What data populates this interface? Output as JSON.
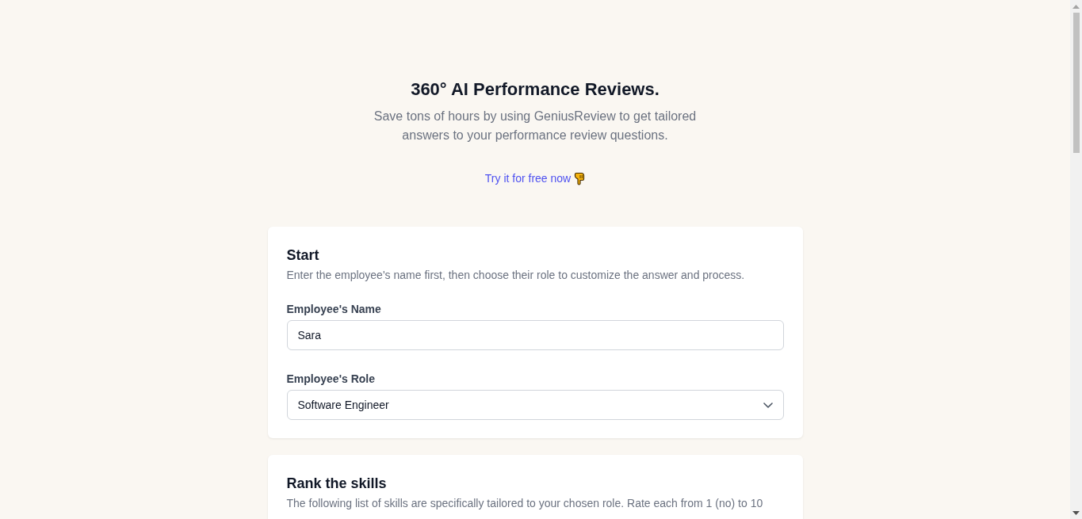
{
  "hero": {
    "title": "360° AI Performance Reviews.",
    "subtitle": "Save tons of hours by using GeniusReview to get tailored answers to your performance review questions.",
    "cta": "Try it for free now"
  },
  "start_card": {
    "title": "Start",
    "description": "Enter the employee's name first, then choose their role to customize the answer and process.",
    "fields": [
      {
        "kind": "text",
        "label": "Employee's Name",
        "value": "Sara"
      },
      {
        "kind": "select",
        "label": "Employee's Role",
        "value": "Software Engineer"
      }
    ]
  },
  "skills_card": {
    "title": "Rank the skills",
    "description": "The following list of skills are specifically tailored to your chosen role. Rate each from 1 (no) to 10"
  }
}
